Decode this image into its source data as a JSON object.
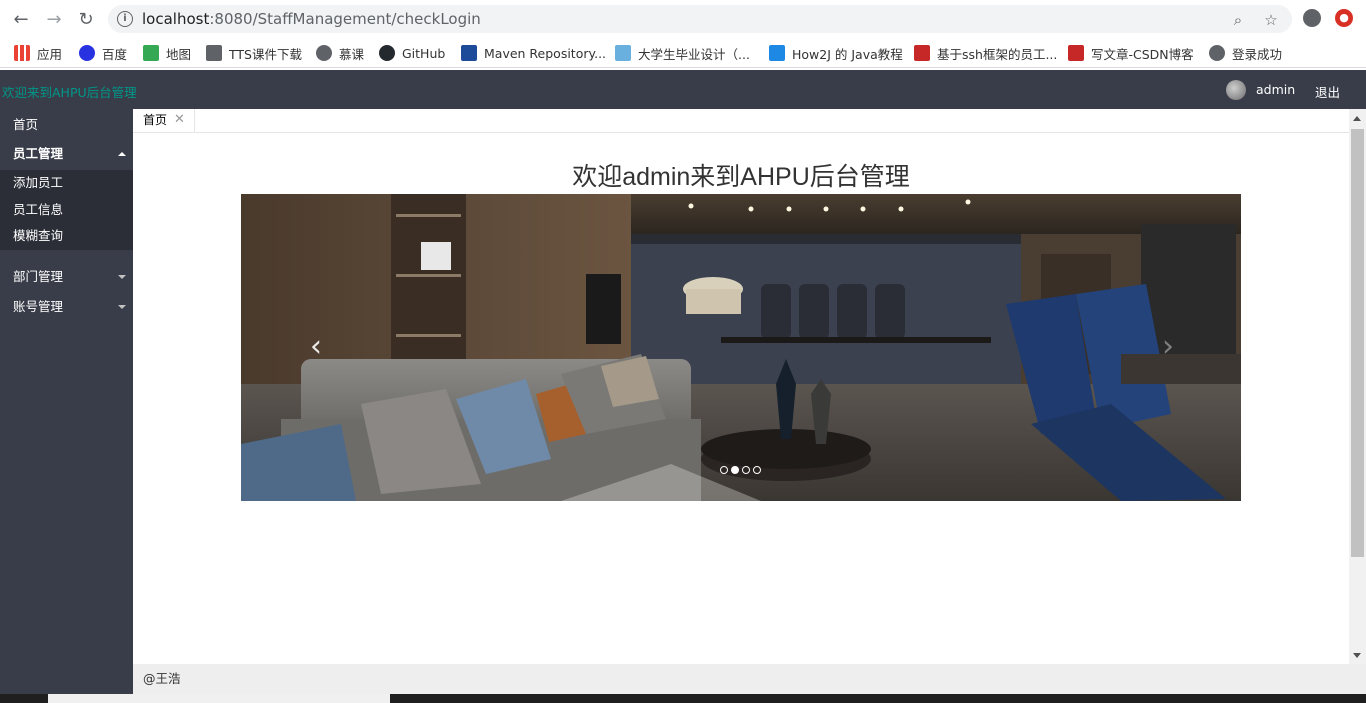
{
  "browser": {
    "url_host": "localhost",
    "url_rest": ":8080/StaffManagement/checkLogin"
  },
  "bookmarks": [
    {
      "label": "应用",
      "color": "#e94235"
    },
    {
      "label": "百度",
      "color": "#2932e1"
    },
    {
      "label": "地图",
      "color": "#34a853"
    },
    {
      "label": "TTS课件下载",
      "color": "#5f6368"
    },
    {
      "label": "慕课",
      "color": "#5f6368"
    },
    {
      "label": "GitHub",
      "color": "#24292e"
    },
    {
      "label": "Maven Repository...",
      "color": "#1e4a9a"
    },
    {
      "label": "大学生毕业设计（...",
      "color": "#6ab0de"
    },
    {
      "label": "How2J 的 Java教程",
      "color": "#1e88e5"
    },
    {
      "label": "基于ssh框架的员工...",
      "color": "#c62828"
    },
    {
      "label": "写文章-CSDN博客",
      "color": "#c62828"
    },
    {
      "label": "登录成功",
      "color": "#5f6368"
    }
  ],
  "header": {
    "title": "欢迎来到AHPU后台管理",
    "user": "admin",
    "logout": "退出"
  },
  "sidebar": {
    "home": "首页",
    "staff": "员工管理",
    "staff_sub": [
      "添加员工",
      "员工信息",
      "模糊查询"
    ],
    "dept": "部门管理",
    "account": "账号管理"
  },
  "tabs": [
    {
      "label": "首页",
      "close": "✕"
    }
  ],
  "main": {
    "welcome": "欢迎admin来到AHPU后台管理",
    "carousel": {
      "slides": 4,
      "active": 1,
      "prev": "‹",
      "next": "›"
    }
  },
  "footer": {
    "text": "@王浩"
  }
}
